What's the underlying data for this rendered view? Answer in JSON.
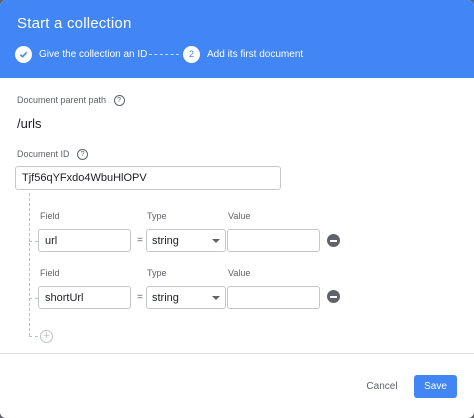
{
  "dialog": {
    "title": "Start a collection",
    "steps": [
      {
        "number": "✓",
        "label": "Give the collection an ID",
        "state": "completed"
      },
      {
        "number": "2",
        "label": "Add its first document",
        "state": "active"
      }
    ]
  },
  "parent_path": {
    "label": "Document parent path",
    "value": "/urls",
    "help_icon": "help-circle-icon"
  },
  "document_id": {
    "label": "Document ID",
    "value": "Tjf56qYFxdo4WbuHlOPV",
    "help_icon": "help-circle-icon"
  },
  "fields": [
    {
      "field_label": "Field",
      "type_label": "Type",
      "value_label": "Value",
      "field": "url",
      "type": "string",
      "value": ""
    },
    {
      "field_label": "Field",
      "type_label": "Type",
      "value_label": "Value",
      "field": "shortUrl",
      "type": "string",
      "value": ""
    }
  ],
  "equals": "=",
  "actions": {
    "cancel": "Cancel",
    "save": "Save"
  },
  "colors": {
    "accent": "#4285f4",
    "header_text": "#ffffff",
    "icon_gray": "#5f6368"
  }
}
